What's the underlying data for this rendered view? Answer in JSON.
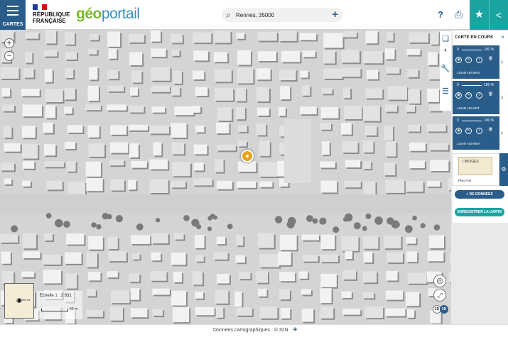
{
  "header": {
    "menu_label": "CARTES",
    "republic_line1": "RÉPUBLIQUE",
    "republic_line2": "FRANÇAISE",
    "logo_part1": "géo",
    "logo_part2": "portail",
    "search_value": "Rennes, 35000",
    "help_label": "?"
  },
  "map": {
    "zoom_in": "+",
    "zoom_out": "−",
    "scale_text": "Echelle 1 : 2 631",
    "scale_distance": "50 m",
    "minimap_label": "Rennes",
    "btn_2d": "2D",
    "btn_3d": "3D"
  },
  "toolbar": {
    "layer_count": "4"
  },
  "panel": {
    "title": "CARTE EN COURS",
    "close": "×",
    "layers": [
      {
        "name": "LIDAR HD MNS",
        "opacity_min": "0",
        "opacity_max": "100 %"
      },
      {
        "name": "LIDAR HD MNT",
        "opacity_min": "0",
        "opacity_max": "100 %"
      },
      {
        "name": "LIDAR HD MNH",
        "opacity_min": "0",
        "opacity_max": "100 %"
      }
    ],
    "plan_name": "Plan IGN",
    "plan_thumb_label": "LIMOGES",
    "add_data_label": "+ DE DONNÉES",
    "save_map_label": "ENREGISTRER LA CARTE"
  },
  "footer": {
    "attribution": "Données cartographiques : ©    IGN",
    "plus": "+"
  },
  "colors": {
    "primary": "#2a5d8a",
    "teal": "#1aa4a2",
    "logo_green": "#7ab929",
    "logo_blue": "#3391c4"
  }
}
